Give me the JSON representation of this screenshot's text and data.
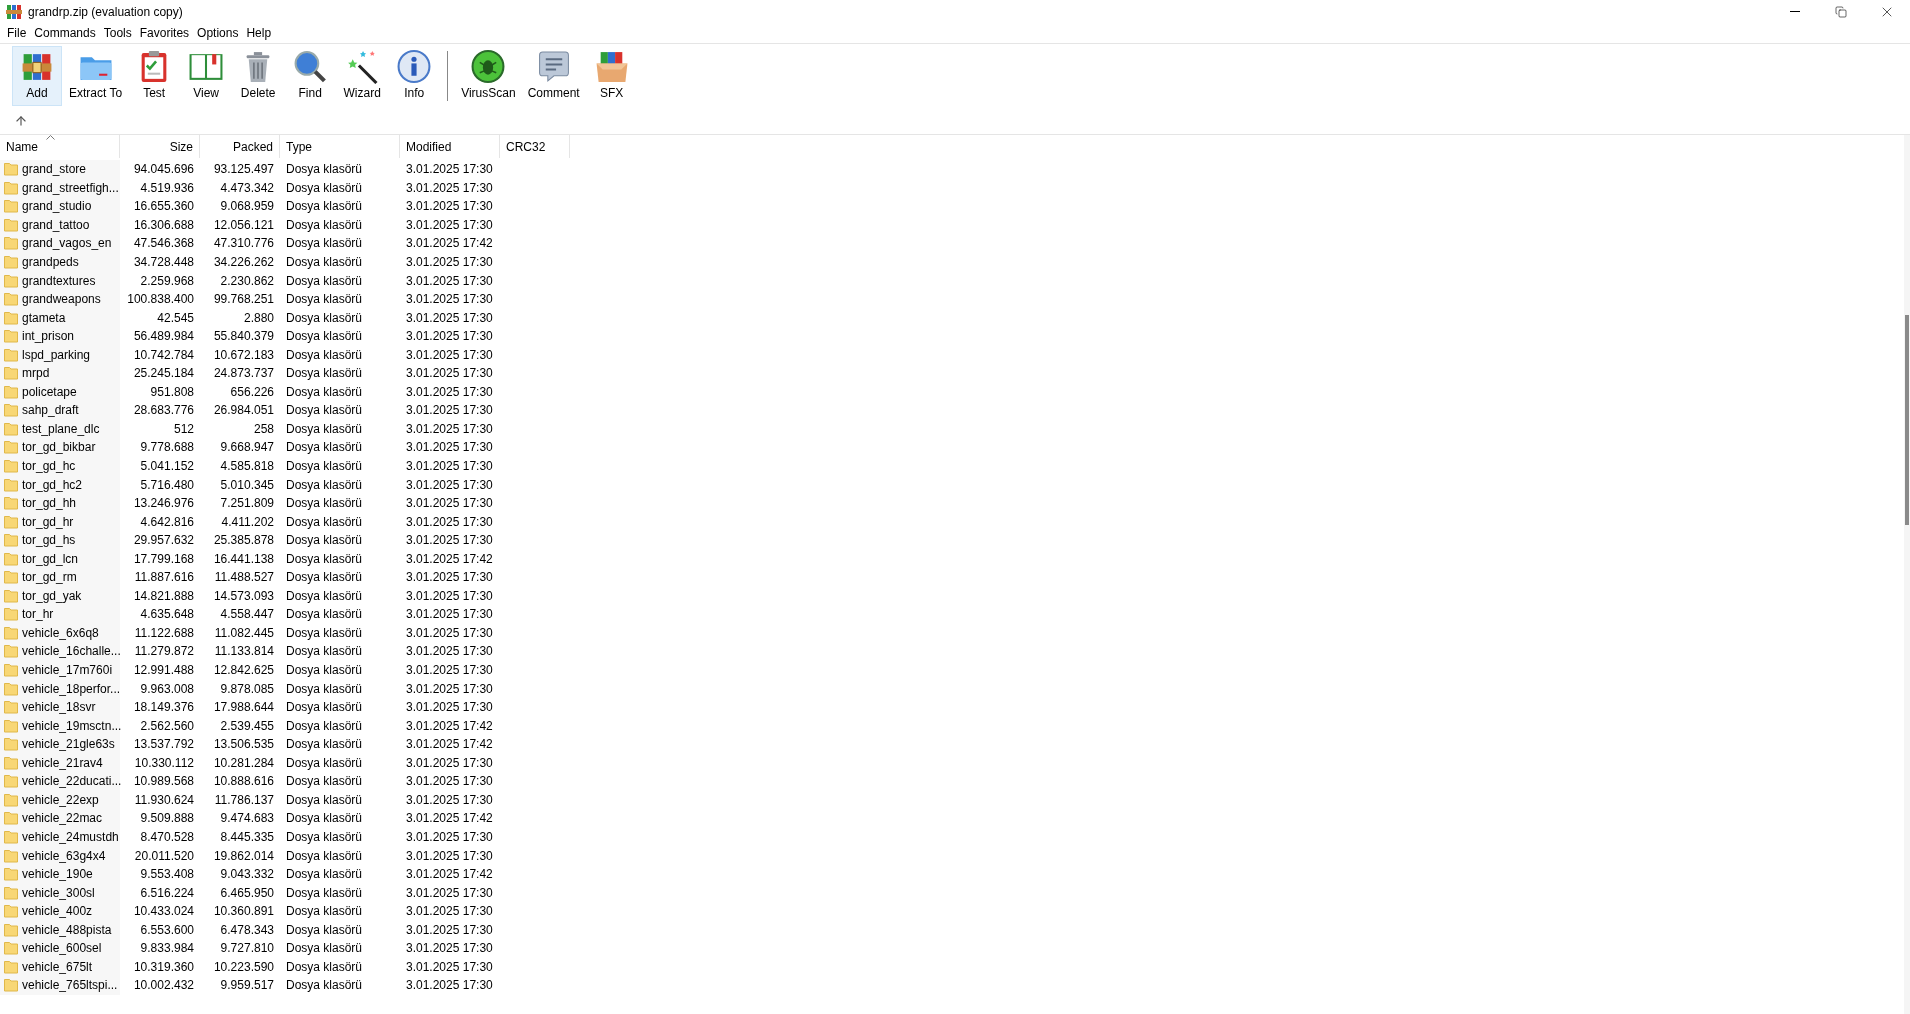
{
  "window": {
    "title": "grandrp.zip (evaluation copy)"
  },
  "menu": [
    "File",
    "Commands",
    "Tools",
    "Favorites",
    "Options",
    "Help"
  ],
  "toolbar": {
    "groups": [
      [
        {
          "label": "Add",
          "selected": true
        },
        {
          "label": "Extract To",
          "selected": false
        },
        {
          "label": "Test",
          "selected": false
        },
        {
          "label": "View",
          "selected": false
        },
        {
          "label": "Delete",
          "selected": false
        },
        {
          "label": "Find",
          "selected": false
        },
        {
          "label": "Wizard",
          "selected": false
        },
        {
          "label": "Info",
          "selected": false
        }
      ],
      [
        {
          "label": "VirusScan",
          "selected": false
        },
        {
          "label": "Comment",
          "selected": false
        },
        {
          "label": "SFX",
          "selected": false
        }
      ]
    ]
  },
  "table": {
    "columns": [
      {
        "label": "Name",
        "sorted": true
      },
      {
        "label": "Size",
        "sorted": false
      },
      {
        "label": "Packed",
        "sorted": false
      },
      {
        "label": "Type",
        "sorted": false
      },
      {
        "label": "Modified",
        "sorted": false
      },
      {
        "label": "CRC32",
        "sorted": false
      }
    ],
    "rows": [
      {
        "name": "grand_store",
        "size": "94.045.696",
        "packed": "93.125.497",
        "type": "Dosya klasörü",
        "modified": "3.01.2025 17:30"
      },
      {
        "name": "grand_streetfigh...",
        "size": "4.519.936",
        "packed": "4.473.342",
        "type": "Dosya klasörü",
        "modified": "3.01.2025 17:30"
      },
      {
        "name": "grand_studio",
        "size": "16.655.360",
        "packed": "9.068.959",
        "type": "Dosya klasörü",
        "modified": "3.01.2025 17:30"
      },
      {
        "name": "grand_tattoo",
        "size": "16.306.688",
        "packed": "12.056.121",
        "type": "Dosya klasörü",
        "modified": "3.01.2025 17:30"
      },
      {
        "name": "grand_vagos_en",
        "size": "47.546.368",
        "packed": "47.310.776",
        "type": "Dosya klasörü",
        "modified": "3.01.2025 17:42"
      },
      {
        "name": "grandpeds",
        "size": "34.728.448",
        "packed": "34.226.262",
        "type": "Dosya klasörü",
        "modified": "3.01.2025 17:30"
      },
      {
        "name": "grandtextures",
        "size": "2.259.968",
        "packed": "2.230.862",
        "type": "Dosya klasörü",
        "modified": "3.01.2025 17:30"
      },
      {
        "name": "grandweapons",
        "size": "100.838.400",
        "packed": "99.768.251",
        "type": "Dosya klasörü",
        "modified": "3.01.2025 17:30"
      },
      {
        "name": "gtameta",
        "size": "42.545",
        "packed": "2.880",
        "type": "Dosya klasörü",
        "modified": "3.01.2025 17:30"
      },
      {
        "name": "int_prison",
        "size": "56.489.984",
        "packed": "55.840.379",
        "type": "Dosya klasörü",
        "modified": "3.01.2025 17:30"
      },
      {
        "name": "lspd_parking",
        "size": "10.742.784",
        "packed": "10.672.183",
        "type": "Dosya klasörü",
        "modified": "3.01.2025 17:30"
      },
      {
        "name": "mrpd",
        "size": "25.245.184",
        "packed": "24.873.737",
        "type": "Dosya klasörü",
        "modified": "3.01.2025 17:30"
      },
      {
        "name": "policetape",
        "size": "951.808",
        "packed": "656.226",
        "type": "Dosya klasörü",
        "modified": "3.01.2025 17:30"
      },
      {
        "name": "sahp_draft",
        "size": "28.683.776",
        "packed": "26.984.051",
        "type": "Dosya klasörü",
        "modified": "3.01.2025 17:30"
      },
      {
        "name": "test_plane_dlc",
        "size": "512",
        "packed": "258",
        "type": "Dosya klasörü",
        "modified": "3.01.2025 17:30"
      },
      {
        "name": "tor_gd_bikbar",
        "size": "9.778.688",
        "packed": "9.668.947",
        "type": "Dosya klasörü",
        "modified": "3.01.2025 17:30"
      },
      {
        "name": "tor_gd_hc",
        "size": "5.041.152",
        "packed": "4.585.818",
        "type": "Dosya klasörü",
        "modified": "3.01.2025 17:30"
      },
      {
        "name": "tor_gd_hc2",
        "size": "5.716.480",
        "packed": "5.010.345",
        "type": "Dosya klasörü",
        "modified": "3.01.2025 17:30"
      },
      {
        "name": "tor_gd_hh",
        "size": "13.246.976",
        "packed": "7.251.809",
        "type": "Dosya klasörü",
        "modified": "3.01.2025 17:30"
      },
      {
        "name": "tor_gd_hr",
        "size": "4.642.816",
        "packed": "4.411.202",
        "type": "Dosya klasörü",
        "modified": "3.01.2025 17:30"
      },
      {
        "name": "tor_gd_hs",
        "size": "29.957.632",
        "packed": "25.385.878",
        "type": "Dosya klasörü",
        "modified": "3.01.2025 17:30"
      },
      {
        "name": "tor_gd_lcn",
        "size": "17.799.168",
        "packed": "16.441.138",
        "type": "Dosya klasörü",
        "modified": "3.01.2025 17:42"
      },
      {
        "name": "tor_gd_rm",
        "size": "11.887.616",
        "packed": "11.488.527",
        "type": "Dosya klasörü",
        "modified": "3.01.2025 17:30"
      },
      {
        "name": "tor_gd_yak",
        "size": "14.821.888",
        "packed": "14.573.093",
        "type": "Dosya klasörü",
        "modified": "3.01.2025 17:30"
      },
      {
        "name": "tor_hr",
        "size": "4.635.648",
        "packed": "4.558.447",
        "type": "Dosya klasörü",
        "modified": "3.01.2025 17:30"
      },
      {
        "name": "vehicle_6x6q8",
        "size": "11.122.688",
        "packed": "11.082.445",
        "type": "Dosya klasörü",
        "modified": "3.01.2025 17:30"
      },
      {
        "name": "vehicle_16challe...",
        "size": "11.279.872",
        "packed": "11.133.814",
        "type": "Dosya klasörü",
        "modified": "3.01.2025 17:30"
      },
      {
        "name": "vehicle_17m760i",
        "size": "12.991.488",
        "packed": "12.842.625",
        "type": "Dosya klasörü",
        "modified": "3.01.2025 17:30"
      },
      {
        "name": "vehicle_18perfor...",
        "size": "9.963.008",
        "packed": "9.878.085",
        "type": "Dosya klasörü",
        "modified": "3.01.2025 17:30"
      },
      {
        "name": "vehicle_18svr",
        "size": "18.149.376",
        "packed": "17.988.644",
        "type": "Dosya klasörü",
        "modified": "3.01.2025 17:30"
      },
      {
        "name": "vehicle_19msctn...",
        "size": "2.562.560",
        "packed": "2.539.455",
        "type": "Dosya klasörü",
        "modified": "3.01.2025 17:42"
      },
      {
        "name": "vehicle_21gle63s",
        "size": "13.537.792",
        "packed": "13.506.535",
        "type": "Dosya klasörü",
        "modified": "3.01.2025 17:42"
      },
      {
        "name": "vehicle_21rav4",
        "size": "10.330.112",
        "packed": "10.281.284",
        "type": "Dosya klasörü",
        "modified": "3.01.2025 17:30"
      },
      {
        "name": "vehicle_22ducati...",
        "size": "10.989.568",
        "packed": "10.888.616",
        "type": "Dosya klasörü",
        "modified": "3.01.2025 17:30"
      },
      {
        "name": "vehicle_22exp",
        "size": "11.930.624",
        "packed": "11.786.137",
        "type": "Dosya klasörü",
        "modified": "3.01.2025 17:30"
      },
      {
        "name": "vehicle_22mac",
        "size": "9.509.888",
        "packed": "9.474.683",
        "type": "Dosya klasörü",
        "modified": "3.01.2025 17:42"
      },
      {
        "name": "vehicle_24mustdh",
        "size": "8.470.528",
        "packed": "8.445.335",
        "type": "Dosya klasörü",
        "modified": "3.01.2025 17:30"
      },
      {
        "name": "vehicle_63g4x4",
        "size": "20.011.520",
        "packed": "19.862.014",
        "type": "Dosya klasörü",
        "modified": "3.01.2025 17:30"
      },
      {
        "name": "vehicle_190e",
        "size": "9.553.408",
        "packed": "9.043.332",
        "type": "Dosya klasörü",
        "modified": "3.01.2025 17:42"
      },
      {
        "name": "vehicle_300sl",
        "size": "6.516.224",
        "packed": "6.465.950",
        "type": "Dosya klasörü",
        "modified": "3.01.2025 17:30"
      },
      {
        "name": "vehicle_400z",
        "size": "10.433.024",
        "packed": "10.360.891",
        "type": "Dosya klasörü",
        "modified": "3.01.2025 17:30"
      },
      {
        "name": "vehicle_488pista",
        "size": "6.553.600",
        "packed": "6.478.343",
        "type": "Dosya klasörü",
        "modified": "3.01.2025 17:30"
      },
      {
        "name": "vehicle_600sel",
        "size": "9.833.984",
        "packed": "9.727.810",
        "type": "Dosya klasörü",
        "modified": "3.01.2025 17:30"
      },
      {
        "name": "vehicle_675lt",
        "size": "10.319.360",
        "packed": "10.223.590",
        "type": "Dosya klasörü",
        "modified": "3.01.2025 17:30"
      },
      {
        "name": "vehicle_765ltspi...",
        "size": "10.002.432",
        "packed": "9.959.517",
        "type": "Dosya klasörü",
        "modified": "3.01.2025 17:30"
      }
    ]
  }
}
